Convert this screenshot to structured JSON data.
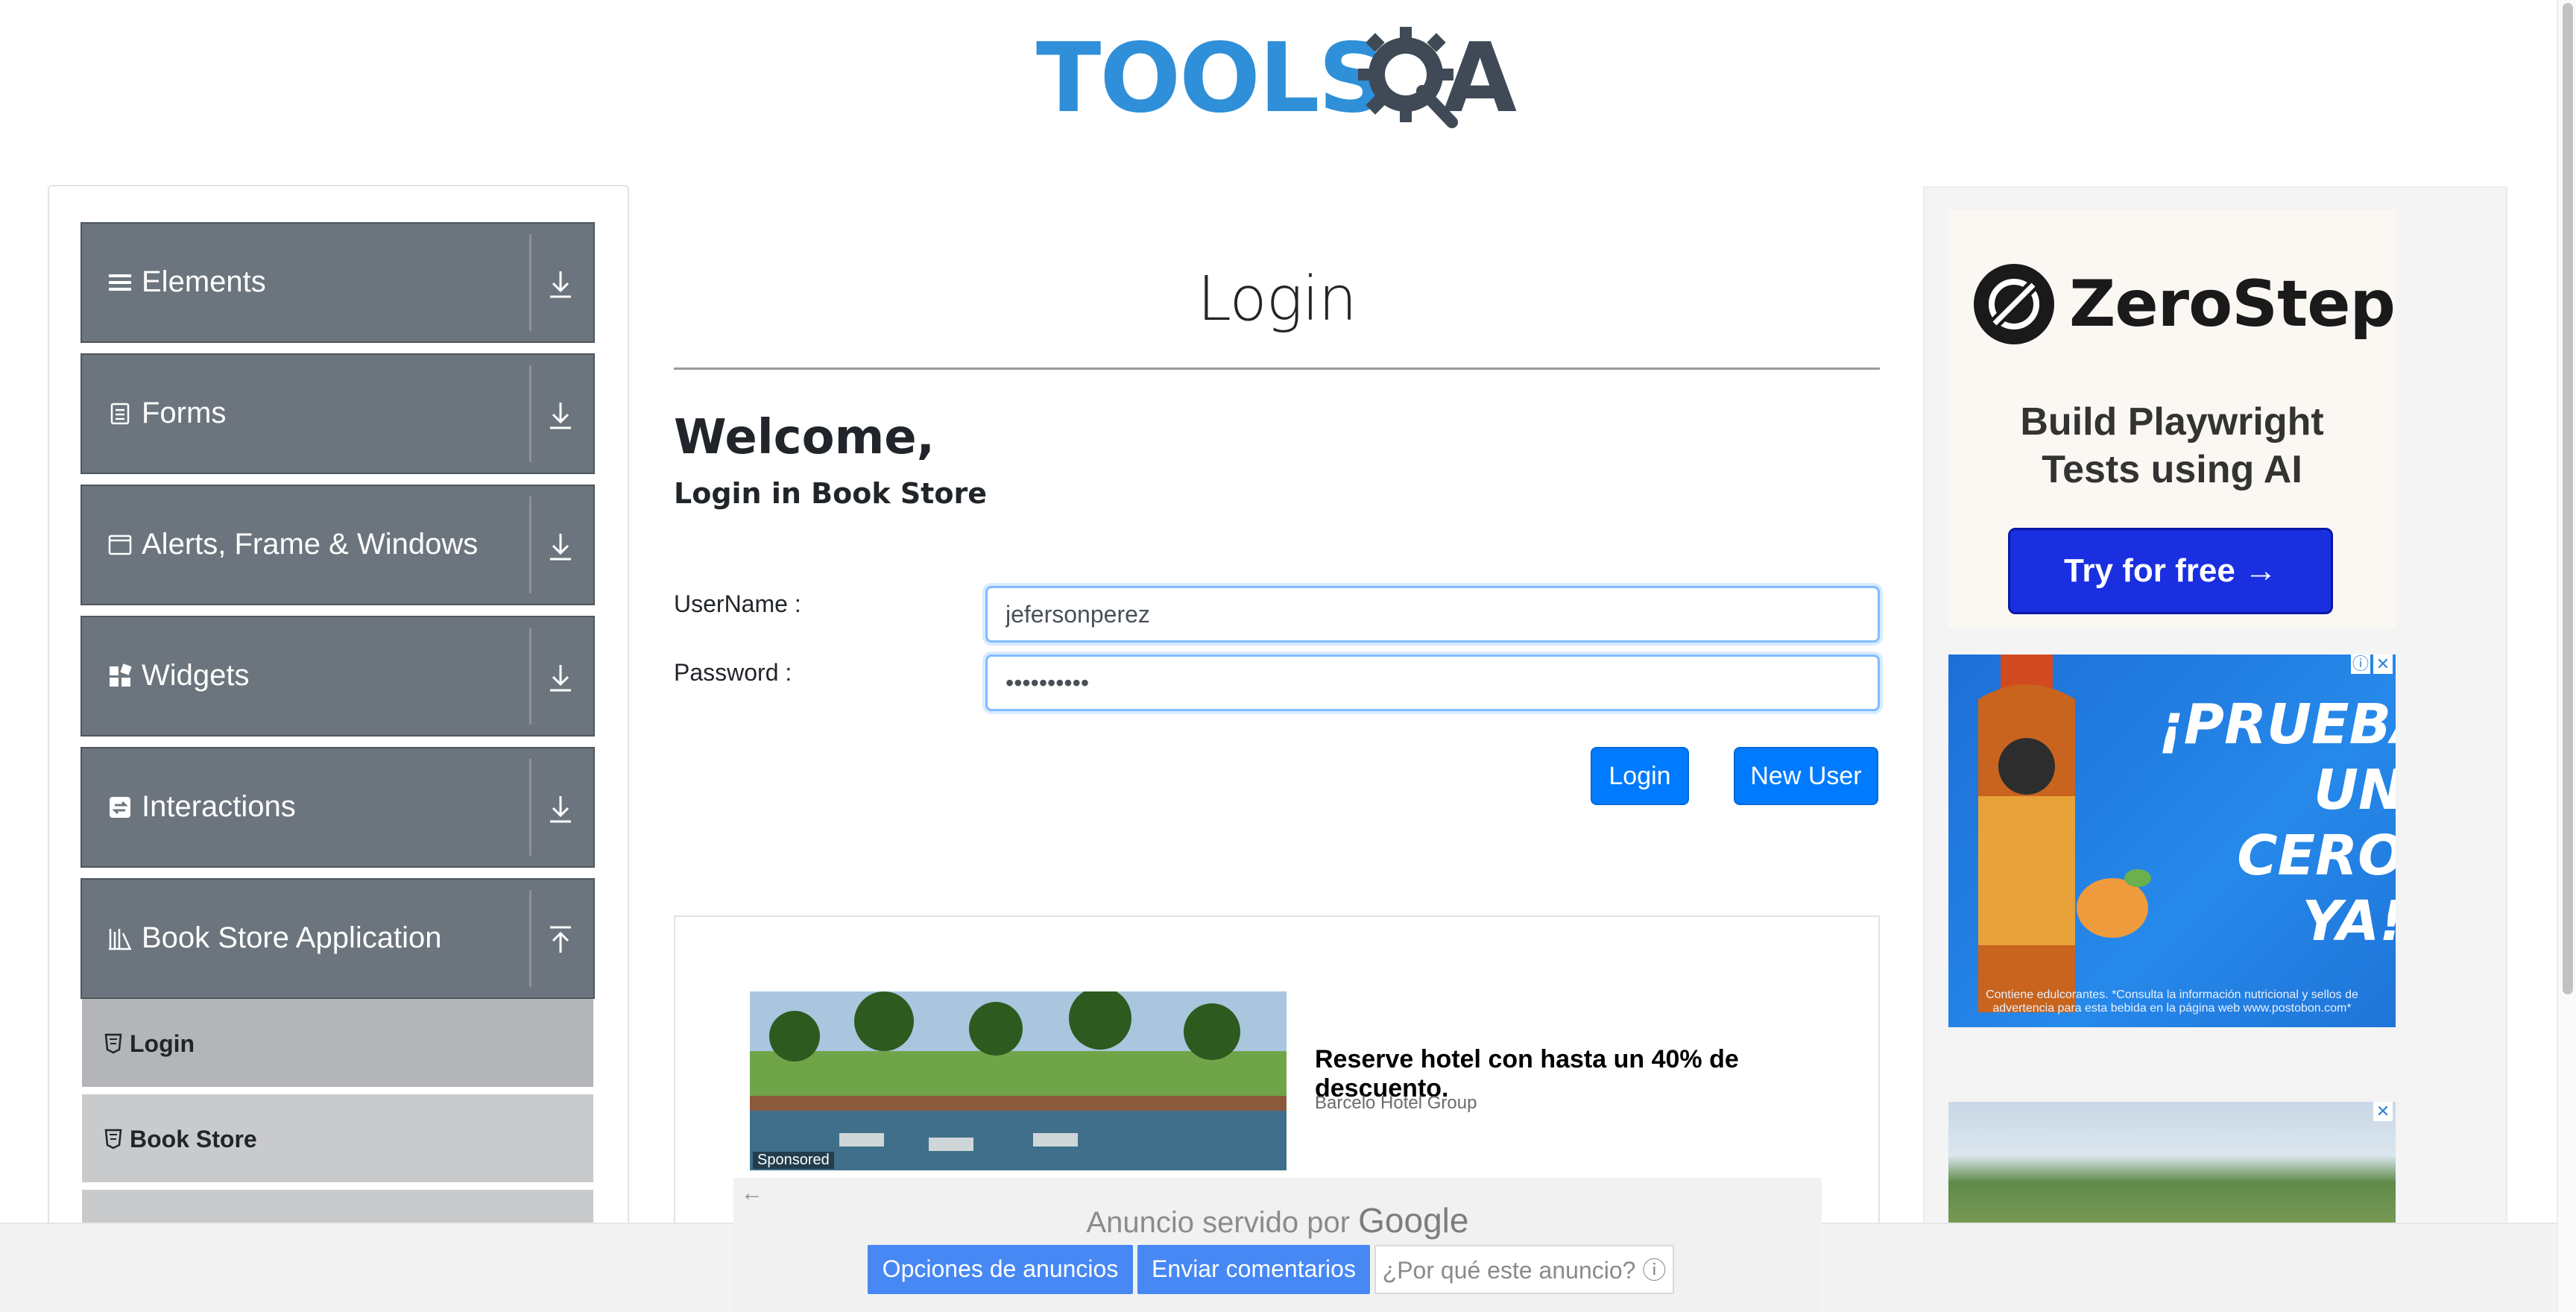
{
  "header": {
    "logo_text_left": "TOOLS",
    "logo_text_right": "A"
  },
  "sidebar": {
    "groups": [
      {
        "label": "Elements",
        "icon": "hamburger-icon",
        "expanded": false
      },
      {
        "label": "Forms",
        "icon": "document-icon",
        "expanded": false
      },
      {
        "label": "Alerts, Frame & Windows",
        "icon": "window-icon",
        "expanded": false
      },
      {
        "label": "Widgets",
        "icon": "widgets-icon",
        "expanded": false
      },
      {
        "label": "Interactions",
        "icon": "interactions-icon",
        "expanded": false
      },
      {
        "label": "Book Store Application",
        "icon": "books-icon",
        "expanded": true
      }
    ],
    "book_store_items": [
      {
        "label": "Login",
        "active": true
      },
      {
        "label": "Book Store",
        "active": false
      }
    ]
  },
  "main": {
    "title": "Login",
    "welcome": "Welcome,",
    "subtitle": "Login in Book Store",
    "username_label": "UserName :",
    "username_value": "jefersonperez",
    "password_label": "Password :",
    "password_value": "••••••••••",
    "login_button": "Login",
    "new_user_button": "New User"
  },
  "content_ad": {
    "badge": "Sponsored",
    "headline": "Reserve hotel con hasta un 40% de descuento.",
    "advertiser": "Barcelo Hotel Group"
  },
  "right_ads": {
    "zerostep_name": "ZeroStep",
    "zerostep_tagline_line1": "Build Playwright",
    "zerostep_tagline_line2": "Tests using AI",
    "zerostep_cta": "Try for free →",
    "tea_headline_line1": "¡PRUEBA UN",
    "tea_headline_line2": "CERO",
    "tea_headline_line3": "YA!",
    "tea_footer": "Contiene edulcorantes. *Consulta la información nutricional y sellos de advertencia para esta bebida en la página web www.postobon.com*"
  },
  "google_bar": {
    "served_by": "Anuncio servido por",
    "brand": "Google",
    "options_button": "Opciones de anuncios",
    "feedback_button": "Enviar comentarios",
    "why_button": "¿Por qué este anuncio? ⓘ"
  },
  "colors": {
    "primary": "#007bff",
    "sidebar_group": "#6c757d",
    "sidebar_active_item": "#b3b5b8",
    "zerostep_cta": "#1a2fe0",
    "google_blue": "#4788f4"
  }
}
